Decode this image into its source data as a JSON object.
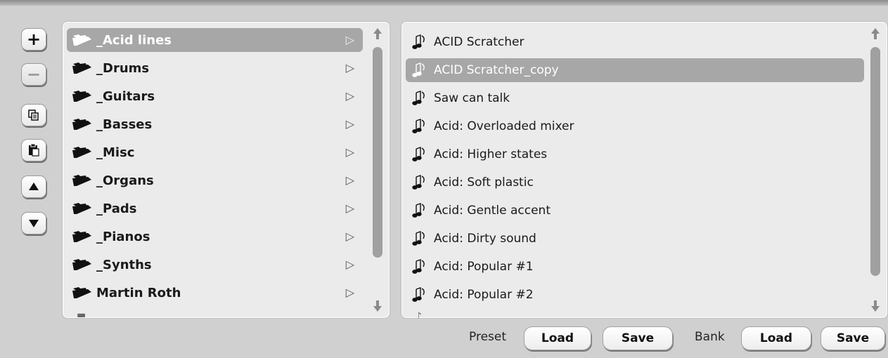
{
  "side_toolbar": {
    "add_icon": "plus-icon",
    "remove_icon": "minus-icon",
    "copy_icon": "copy-icon",
    "paste_icon": "paste-icon",
    "up_icon": "move-up-icon",
    "down_icon": "move-down-icon"
  },
  "banks": {
    "items": [
      {
        "label": "_Acid lines",
        "selected": true
      },
      {
        "label": "_Drums"
      },
      {
        "label": "_Guitars"
      },
      {
        "label": "_Basses"
      },
      {
        "label": "_Misc"
      },
      {
        "label": "_Organs"
      },
      {
        "label": "_Pads"
      },
      {
        "label": "_Pianos"
      },
      {
        "label": "_Synths"
      },
      {
        "label": "Martin Roth"
      }
    ],
    "arrow": "▷"
  },
  "presets": {
    "items": [
      {
        "label": "ACID Scratcher"
      },
      {
        "label": "ACID Scratcher_copy",
        "selected": true
      },
      {
        "label": "Saw can talk"
      },
      {
        "label": "Acid: Overloaded mixer"
      },
      {
        "label": "Acid: Higher states"
      },
      {
        "label": "Acid: Soft plastic"
      },
      {
        "label": "Acid: Gentle accent"
      },
      {
        "label": "Acid: Dirty sound"
      },
      {
        "label": "Acid: Popular #1"
      },
      {
        "label": "Acid: Popular #2"
      }
    ]
  },
  "footer": {
    "preset_label": "Preset",
    "preset_load": "Load",
    "preset_save": "Save",
    "bank_label": "Bank",
    "bank_load": "Load",
    "bank_save": "Save"
  },
  "colors": {
    "background": "#d0d0d0",
    "panel": "#ebebeb",
    "selection": "#a7a7a7"
  }
}
